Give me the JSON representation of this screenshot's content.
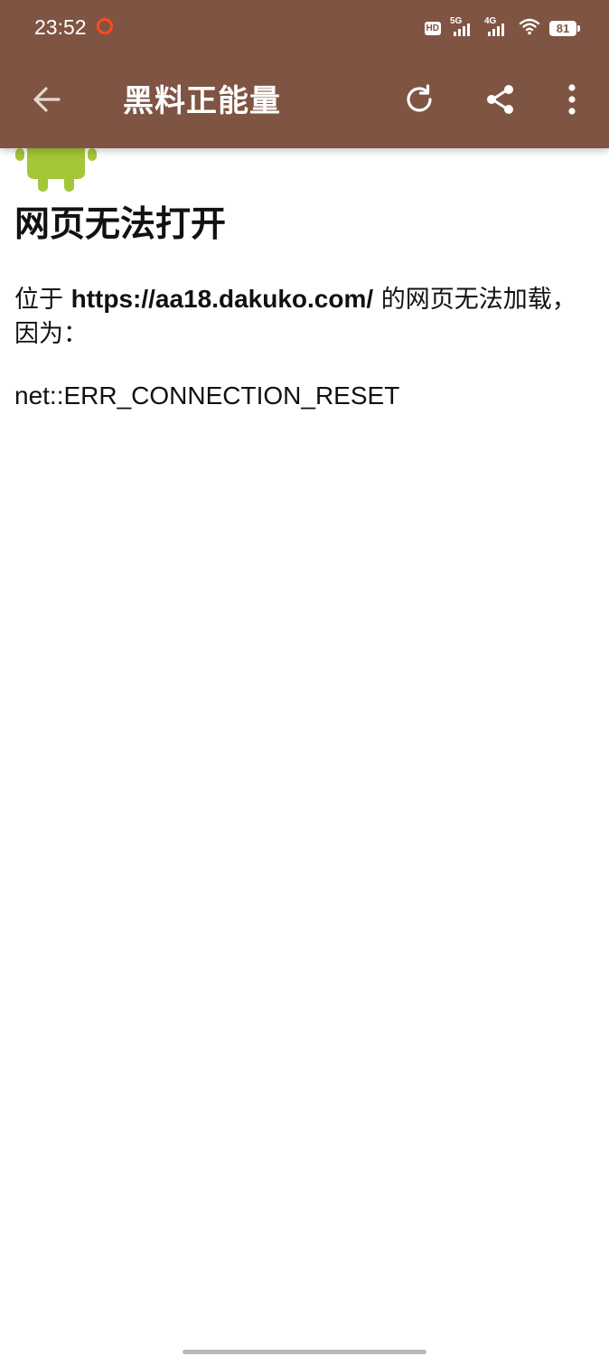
{
  "status_bar": {
    "time": "23:52",
    "hd_label": "HD",
    "sim1_label": "5G",
    "sim2_label": "4G",
    "battery_level": "81"
  },
  "toolbar": {
    "title": "黑料正能量",
    "back_icon": "arrow-left-icon",
    "reload_icon": "refresh-icon",
    "share_icon": "share-icon",
    "more_icon": "more-vertical-icon"
  },
  "error_page": {
    "title": "网页无法打开",
    "desc_prefix": "位于 ",
    "url": "https://aa18.dakuko.com/",
    "desc_suffix": " 的网页无法加载，因为：",
    "error_code": "net::ERR_CONNECTION_RESET"
  },
  "colors": {
    "app_bar": "#7f5443",
    "android_green": "#a4c639",
    "record_dot": "#ff4a1c"
  }
}
